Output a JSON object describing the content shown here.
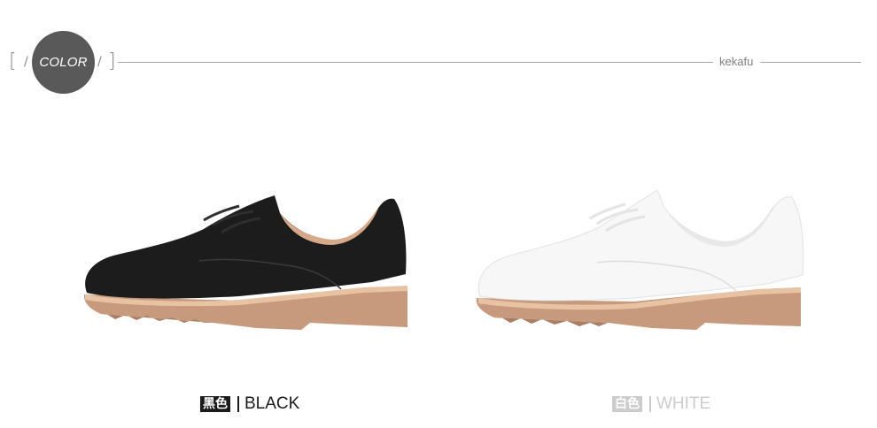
{
  "header": {
    "color_label": "COLOR",
    "brand": "kekafu"
  },
  "variants": [
    {
      "badge": "黑色",
      "name": "BLACK",
      "text_color": "#1a1a1a",
      "shoe_color": "#1c1c1c"
    },
    {
      "badge": "白色",
      "name": "WHITE",
      "text_color": "#cccccc",
      "shoe_color": "#f7f7f7"
    }
  ],
  "colors": {
    "circle": "#595959",
    "line": "#a8a8a8",
    "sole": "#c79a7e",
    "sole_top": "#e7c3a4"
  }
}
